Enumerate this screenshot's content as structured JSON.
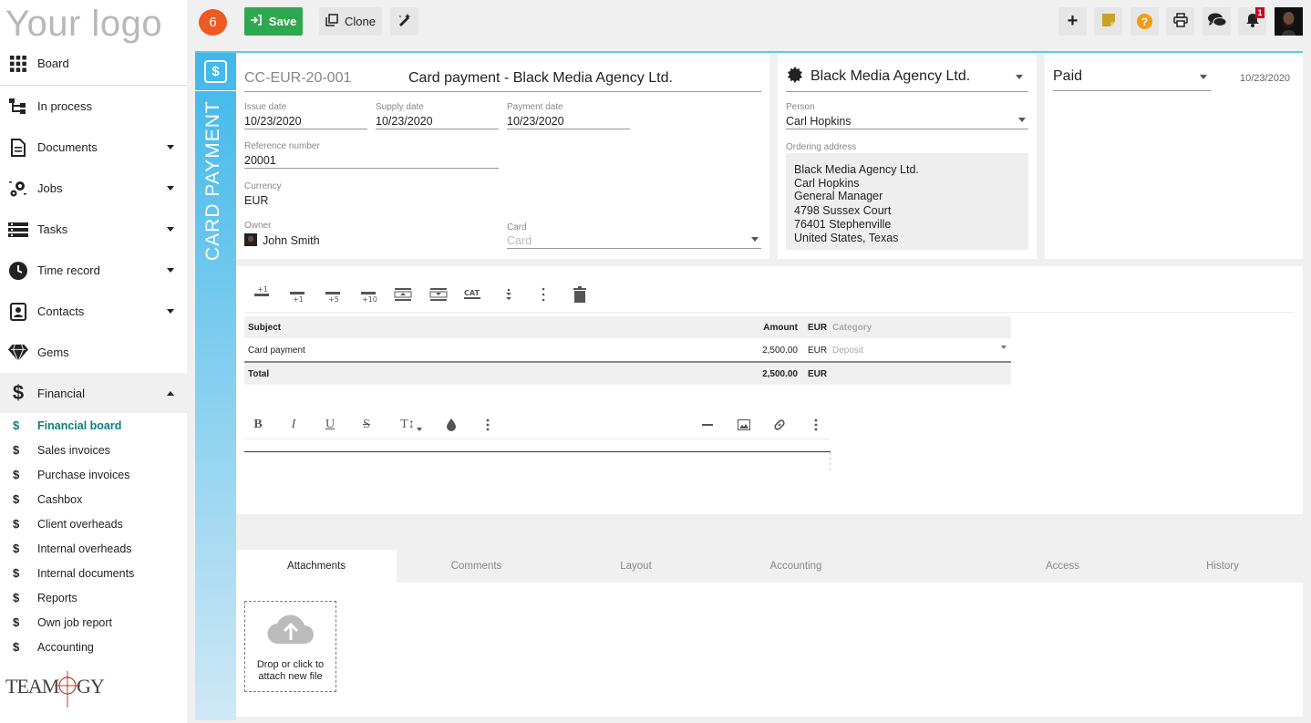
{
  "logo_text": "Your logo",
  "sidebar": {
    "items": [
      {
        "label": "Board",
        "icon": "grid-icon"
      },
      {
        "label": "In process",
        "icon": "hierarchy-icon"
      },
      {
        "label": "Documents",
        "icon": "document-icon"
      },
      {
        "label": "Jobs",
        "icon": "gears-icon"
      },
      {
        "label": "Tasks",
        "icon": "tasks-icon"
      },
      {
        "label": "Time record",
        "icon": "clock-icon"
      },
      {
        "label": "Contacts",
        "icon": "contact-icon"
      },
      {
        "label": "Gems",
        "icon": "gem-icon"
      },
      {
        "label": "Financial",
        "icon": "dollar-icon"
      }
    ],
    "financial_sub": [
      "Financial board",
      "Sales invoices",
      "Purchase invoices",
      "Cashbox",
      "Client overheads",
      "Internal overheads",
      "Internal documents",
      "Reports",
      "Own job report",
      "Accounting"
    ],
    "brand": "TEAMOGY"
  },
  "topbar": {
    "badge_count": "6",
    "save_label": "Save",
    "clone_label": "Clone",
    "notification_count": "1"
  },
  "colors": {
    "accent": "#5bc8ef",
    "save": "#2ea84f",
    "badge": "#ee5a24",
    "active": "#0a7d80"
  },
  "document": {
    "type_label": "CARD PAYMENT",
    "number": "CC-EUR-20-001",
    "title": "Card payment - Black Media Agency Ltd.",
    "issue_date_label": "Issue date",
    "issue_date": "10/23/2020",
    "supply_date_label": "Supply date",
    "supply_date": "10/23/2020",
    "payment_date_label": "Payment date",
    "payment_date": "10/23/2020",
    "reference_label": "Reference number",
    "reference": "20001",
    "currency_label": "Currency",
    "currency": "EUR",
    "owner_label": "Owner",
    "owner": "John Smith",
    "card_label": "Card",
    "card_placeholder": "Card"
  },
  "client": {
    "company": "Black Media Agency Ltd.",
    "person_label": "Person",
    "person": "Carl Hopkins",
    "address_label": "Ordering address",
    "address_lines": [
      "Black Media Agency Ltd.",
      "Carl Hopkins",
      "General Manager",
      "4798 Sussex Court",
      "76401 Stephenville",
      "United States, Texas"
    ]
  },
  "status": {
    "value": "Paid",
    "date": "10/23/2020"
  },
  "items_toolbar": [
    "+1",
    "+1",
    "+5",
    "+10",
    "CAT"
  ],
  "table": {
    "headers": {
      "subject": "Subject",
      "amount": "Amount",
      "currency": "EUR",
      "category": "Category"
    },
    "rows": [
      {
        "subject": "Card payment",
        "amount": "2,500.00",
        "currency": "EUR",
        "category": "Deposit"
      }
    ],
    "total": {
      "label": "Total",
      "amount": "2,500.00",
      "currency": "EUR"
    }
  },
  "editor_tools": {
    "bold": "B",
    "italic": "I",
    "underline": "U",
    "strike": "S",
    "size": "T↕"
  },
  "tabs": [
    "Attachments",
    "Comments",
    "Layout",
    "Accounting",
    "Access",
    "History"
  ],
  "upload": {
    "line1": "Drop or click to",
    "line2": "attach new file"
  }
}
